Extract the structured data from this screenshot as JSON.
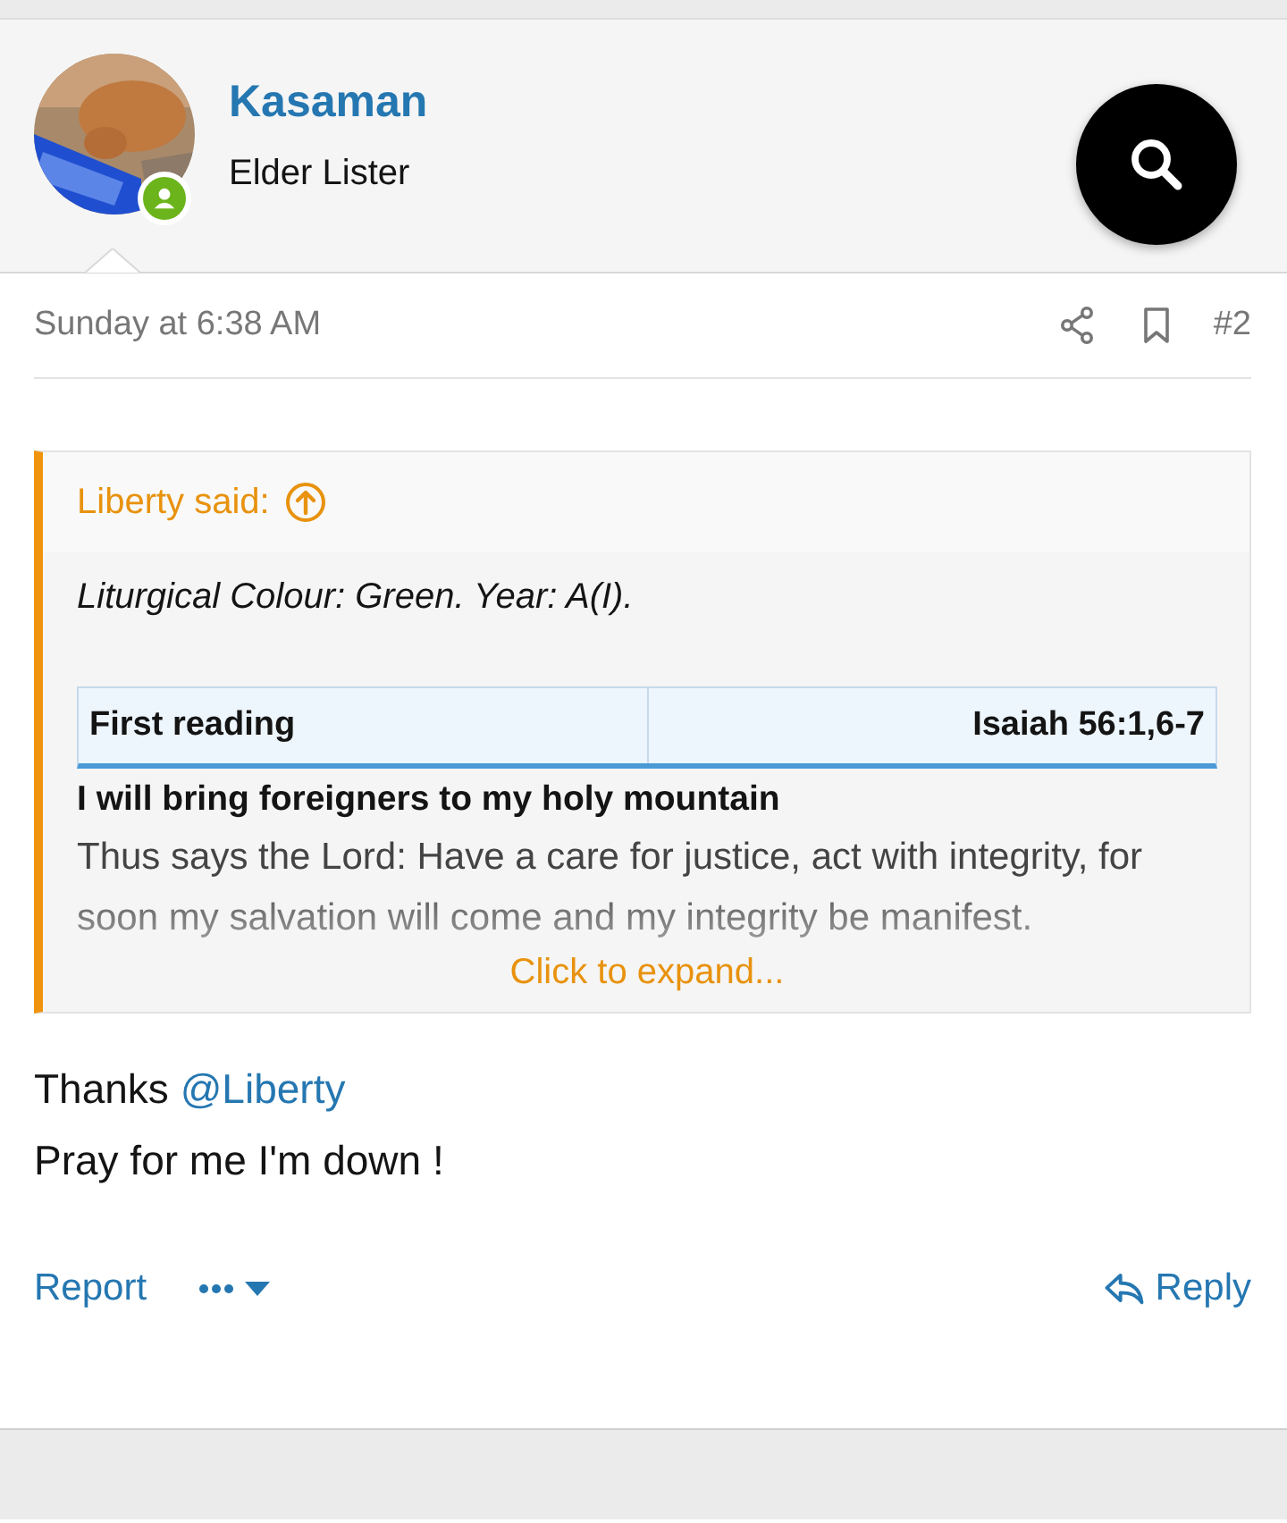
{
  "author": {
    "name": "Kasaman",
    "title": "Elder Lister",
    "online": true
  },
  "post": {
    "date": "Sunday at 6:38 AM",
    "number": "#2"
  },
  "quote": {
    "attribution": "Liberty said:",
    "intro": "Liturgical Colour: Green. Year: A(I).",
    "table": {
      "cells": [
        "First reading",
        "Isaiah 56:1,6-7"
      ]
    },
    "heading": "I will bring foreigners to my holy mountain",
    "text": "Thus says the Lord: Have a care for justice, act with integrity, for soon my salvation will come and my integrity be manifest.",
    "expand": "Click to expand..."
  },
  "message": {
    "text": "Thanks",
    "mention": "@Liberty",
    "line2": "Pray for me I'm down !"
  },
  "actions": {
    "report": "Report",
    "reply": "Reply"
  }
}
